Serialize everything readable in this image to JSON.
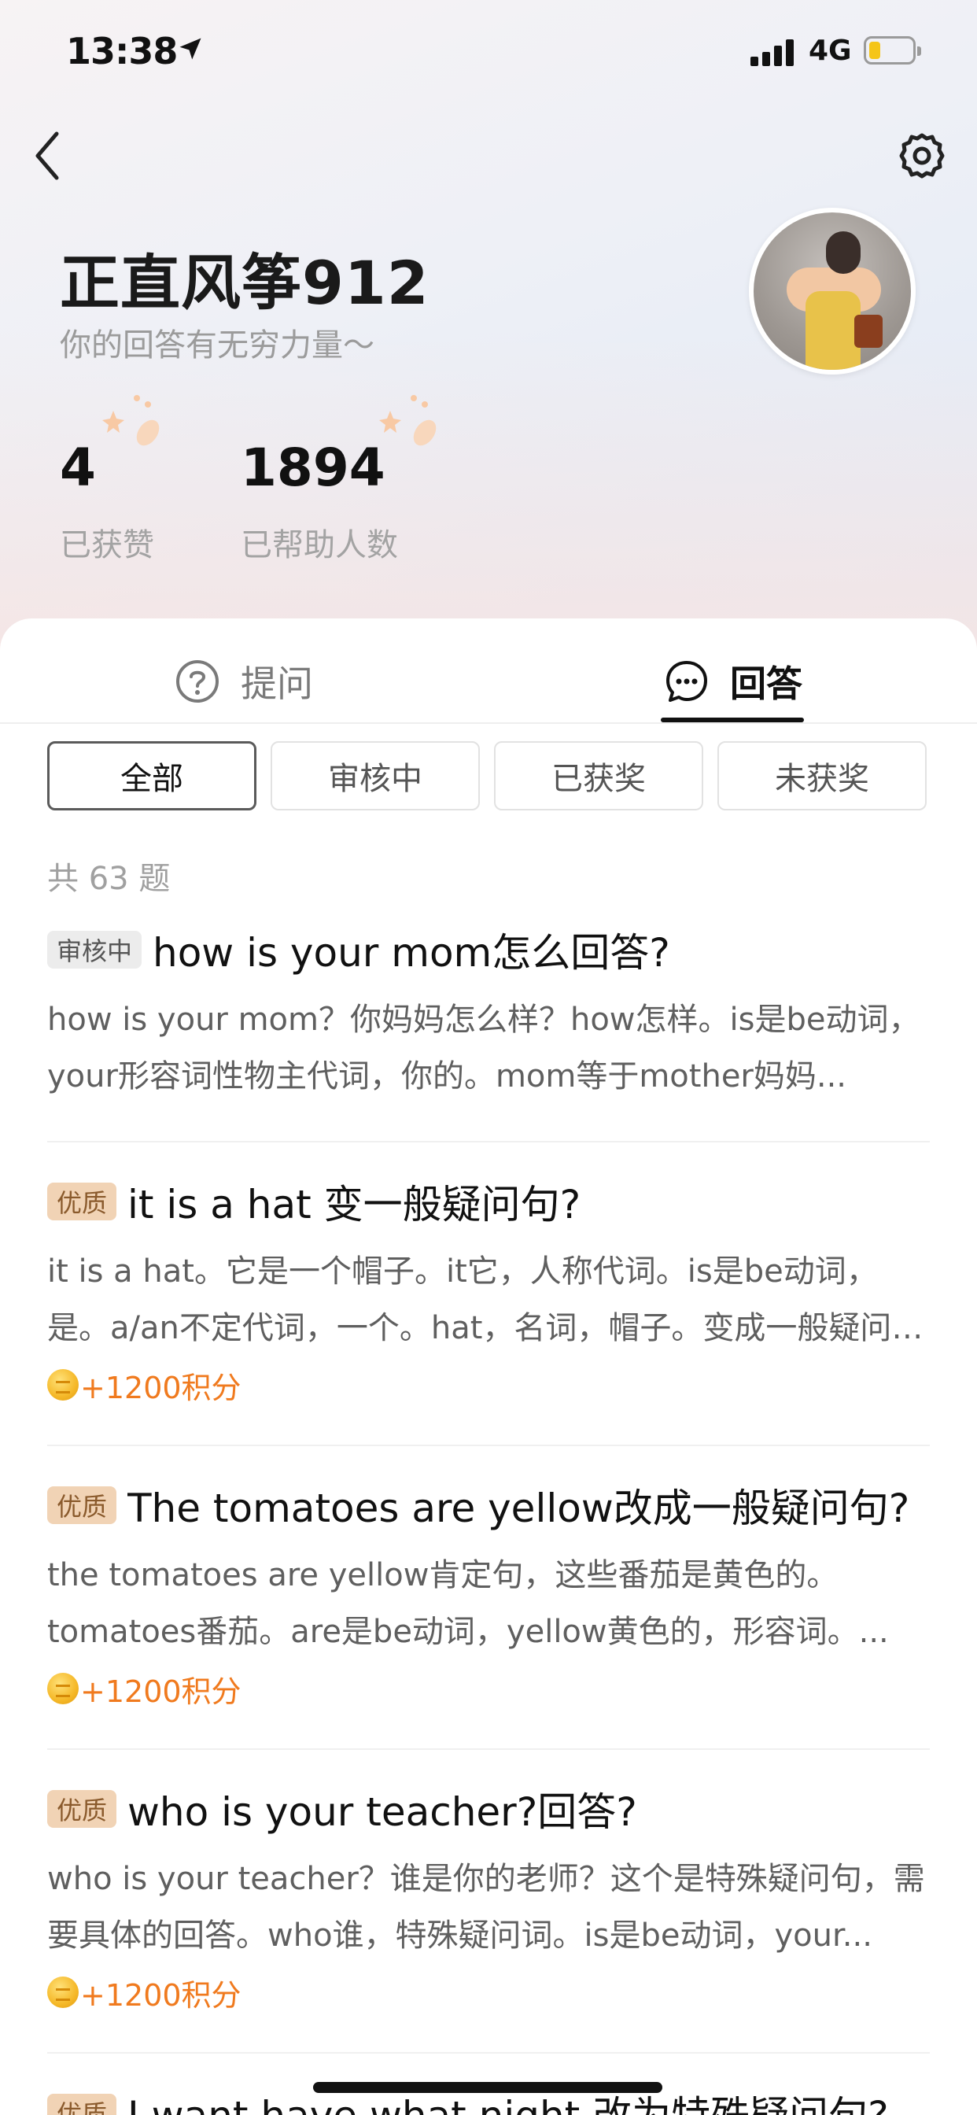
{
  "status_bar": {
    "time": "13:38",
    "network": "4G",
    "battery_level_fraction": 0.2
  },
  "profile": {
    "name": "正直风筝912",
    "motto": "你的回答有无穷力量～",
    "stats": [
      {
        "value": "4",
        "label": "已获赞"
      },
      {
        "value": "1894",
        "label": "已帮助人数"
      }
    ]
  },
  "tabs": [
    {
      "label": "提问",
      "icon": "question-circle-icon",
      "active": false
    },
    {
      "label": "回答",
      "icon": "chat-bubble-icon",
      "active": true
    }
  ],
  "filters": [
    {
      "label": "全部",
      "active": true
    },
    {
      "label": "审核中",
      "active": false
    },
    {
      "label": "已获奖",
      "active": false
    },
    {
      "label": "未获奖",
      "active": false
    }
  ],
  "total_count": "共 63 题",
  "questions": [
    {
      "badge": "审核中",
      "badge_type": "review",
      "title": "how is your mom怎么回答?",
      "snippet": "how is your mom？你妈妈怎么样？how怎样。is是be动词，your形容词性物主代词，你的。mom等于mother妈妈...",
      "reward": ""
    },
    {
      "badge": "优质",
      "badge_type": "quality",
      "title": "it is a hat 变一般疑问句?",
      "snippet": "it is a hat。它是一个帽子。it它，人称代词。is是be动词，是。a/an不定代词，一个。hat，名词，帽子。变成一般疑问句...",
      "reward": "+1200积分"
    },
    {
      "badge": "优质",
      "badge_type": "quality",
      "title": "The tomatoes are yellow改成一般疑问句?",
      "snippet": "the tomatoes are yellow肯定句，这些番茄是黄色的。tomatoes番茄。are是be动词，yellow黄色的，形容词。...",
      "reward": "+1200积分"
    },
    {
      "badge": "优质",
      "badge_type": "quality",
      "title": "who is your teacher?回答?",
      "snippet": "who is your teacher？谁是你的老师？这个是特殊疑问句，需要具体的回答。who谁，特殊疑问词。is是be动词，your...",
      "reward": "+1200积分"
    },
    {
      "badge": "优质",
      "badge_type": "quality",
      "title": "I want have what night 改为特殊疑问句?",
      "snippet": "",
      "reward": ""
    }
  ],
  "colors": {
    "accent_reward": "#f07a1e",
    "badge_quality_bg": "#f1d3b5",
    "badge_review_bg": "#ececec",
    "tab_active": "#111111"
  }
}
